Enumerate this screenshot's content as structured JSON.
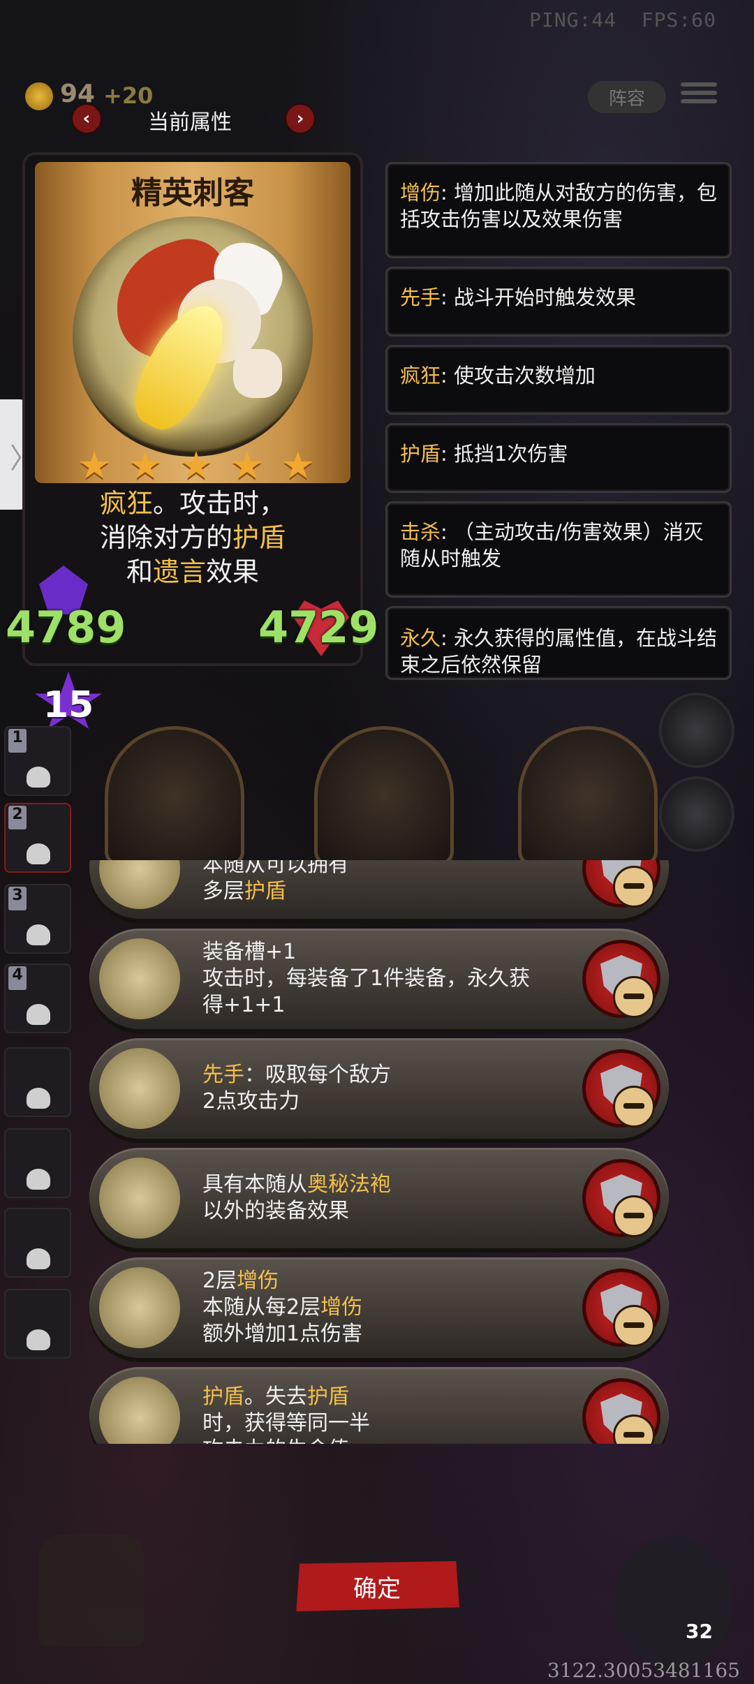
{
  "status": {
    "ping": "PING:44",
    "fps": "FPS:60"
  },
  "resources": {
    "gold": "94",
    "gold_gain": "+20"
  },
  "top_buttons": {
    "lineup": "阵容"
  },
  "attr_nav": {
    "title": "当前属性",
    "prev": "‹",
    "next": "›"
  },
  "card": {
    "name": "精英刺客",
    "stars": 5,
    "desc_line1_kw": "疯狂",
    "desc_line1_rest": "。攻击时，",
    "desc_line2_pre": "消除对方的",
    "desc_line2_kw": "护盾",
    "desc_line3_pre": "和",
    "desc_line3_kw": "遗言",
    "desc_line3_post": "效果",
    "attack": "4789",
    "health": "4729",
    "level": "15"
  },
  "keywords": [
    {
      "term": "增伤",
      "desc": ": 增加此随从对敌方的伤害，包括攻击伤害以及效果伤害"
    },
    {
      "term": "先手",
      "desc": ": 战斗开始时触发效果"
    },
    {
      "term": "疯狂",
      "desc": ": 使攻击次数增加"
    },
    {
      "term": "护盾",
      "desc": ": 抵挡1次伤害"
    },
    {
      "term": "击杀",
      "desc": ": （主动攻击/伤害效果）消灭随从时触发"
    },
    {
      "term": "永久",
      "desc": ": 永久获得的属性值，在战斗结束之后依然保留"
    }
  ],
  "slots": [
    "1",
    "2",
    "3",
    "4"
  ],
  "effects": [
    {
      "line1_pre": "本随从可以拥有",
      "line1_kw": "",
      "line1_post": "",
      "line2_pre": "多层",
      "line2_kw": "护盾",
      "line2_post": "",
      "line3": ""
    },
    {
      "line1_pre": "装备槽+1",
      "line1_kw": "",
      "line1_post": "",
      "line2_pre": "攻击时，每装备了1件装备，永久获",
      "line2_kw": "",
      "line2_post": "",
      "line3": "得+1+1"
    },
    {
      "line1_pre": "",
      "line1_kw": "先手",
      "line1_post": "：吸取每个敌方",
      "line2_pre": "2点攻击力",
      "line2_kw": "",
      "line2_post": "",
      "line3": ""
    },
    {
      "line1_pre": "具有本随从",
      "line1_kw": "奥秘法袍",
      "line1_post": "",
      "line2_pre": "以外的装备效果",
      "line2_kw": "",
      "line2_post": "",
      "line3": ""
    },
    {
      "line1_pre": "2层",
      "line1_kw": "增伤",
      "line1_post": "",
      "line2_pre": "本随从每2层",
      "line2_kw": "增伤",
      "line2_post": "",
      "line3": "额外增加1点伤害"
    },
    {
      "line1_pre": "",
      "line1_kw": "护盾",
      "line1_post": "。失去",
      "line1_kw2": "护盾",
      "line2_pre": "时，获得等同一半",
      "line2_kw": "",
      "line2_post": "",
      "line3": "攻击力的生命值"
    }
  ],
  "confirm_label": "确定",
  "bottom": {
    "hp": "32",
    "coord": "3122.30053481165"
  },
  "colors": {
    "keyword": "#f4c04a",
    "stat": "#9ee068",
    "confirm": "#b01a1a"
  }
}
